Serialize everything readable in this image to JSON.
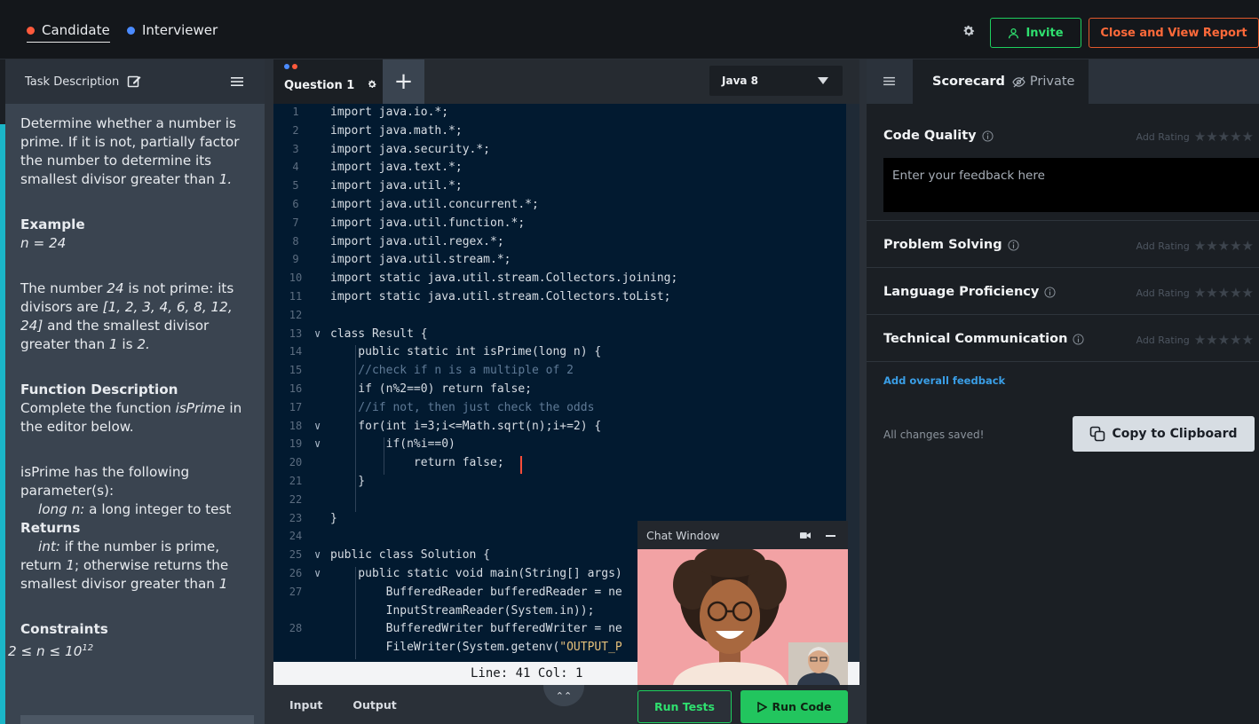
{
  "roles": {
    "candidate": "Candidate",
    "interviewer": "Interviewer",
    "candidate_color": "#ff5a3c",
    "interviewer_color": "#4b8bff"
  },
  "topbar": {
    "invite_label": "Invite",
    "report_label": "Close and View Report"
  },
  "task": {
    "header": "Task Description",
    "intro": "Determine whether a number is prime. If it is not, partially factor the number to determine its smallest divisor greater than ",
    "intro_num": "1.",
    "example_heading": "Example",
    "example_value": "n = 24",
    "explain_a": "The number ",
    "explain_n": "24",
    "explain_b": " is not prime: its divisors are ",
    "explain_divs": "[1, 2, 3, 4, 6, 8, 12, 24]",
    "explain_c": " and the smallest divisor greater than ",
    "explain_one": "1",
    "explain_d": " is ",
    "explain_two": "2.",
    "func_heading": "Function Description",
    "func_a": "Complete the function ",
    "func_name": "isPrime",
    "func_b": " in the editor below.",
    "params_intro": "isPrime has the following parameter(s):",
    "param_name": "long n:",
    "param_desc": " a long integer to test",
    "returns_heading": "Returns",
    "ret_type": "int:",
    "ret_a": " if the number is prime, return ",
    "ret_one": "1",
    "ret_b": "; otherwise returns the smallest divisor greater than ",
    "ret_one_b": "1",
    "constraints_heading": "Constraints",
    "constraint": "2 ≤ n ≤ 10",
    "constraint_exp": "12"
  },
  "editor": {
    "tab_label": "Question 1",
    "add_tab": "+",
    "language": "Java 8",
    "status": "Line: 41 Col: 1",
    "lines": [
      {
        "n": "1",
        "text": "import java.io.*;"
      },
      {
        "n": "2",
        "text": "import java.math.*;"
      },
      {
        "n": "3",
        "text": "import java.security.*;"
      },
      {
        "n": "4",
        "text": "import java.text.*;"
      },
      {
        "n": "5",
        "text": "import java.util.*;"
      },
      {
        "n": "6",
        "text": "import java.util.concurrent.*;"
      },
      {
        "n": "7",
        "text": "import java.util.function.*;"
      },
      {
        "n": "8",
        "text": "import java.util.regex.*;"
      },
      {
        "n": "9",
        "text": "import java.util.stream.*;"
      },
      {
        "n": "10",
        "text": "import static java.util.stream.Collectors.joining;"
      },
      {
        "n": "11",
        "text": "import static java.util.stream.Collectors.toList;"
      },
      {
        "n": "12",
        "text": ""
      },
      {
        "n": "13",
        "text": "class Result {"
      },
      {
        "n": "14",
        "text": "    public static int isPrime(long n) {"
      },
      {
        "n": "15",
        "text": "    //check if n is a multiple of 2"
      },
      {
        "n": "16",
        "text": "    if (n%2==0) return false;"
      },
      {
        "n": "17",
        "text": "    //if not, then just check the odds"
      },
      {
        "n": "18",
        "text": "    for(int i=3;i<=Math.sqrt(n);i+=2) {"
      },
      {
        "n": "19",
        "text": "        if(n%i==0)"
      },
      {
        "n": "20",
        "text": "            return false;"
      },
      {
        "n": "21",
        "text": "    }"
      },
      {
        "n": "22",
        "text": ""
      },
      {
        "n": "23",
        "text": "}"
      },
      {
        "n": "24",
        "text": ""
      },
      {
        "n": "25",
        "text": "public class Solution {"
      },
      {
        "n": "26",
        "text": "    public static void main(String[] args)"
      },
      {
        "n": "27",
        "text": "        BufferedReader bufferedReader = ne"
      },
      {
        "n": "",
        "text": "        InputStreamReader(System.in));"
      },
      {
        "n": "28",
        "text": "        BufferedWriter bufferedWriter = ne"
      },
      {
        "n": "",
        "text": "        FileWriter(System.getenv(\"OUTPUT_P"
      }
    ]
  },
  "io": {
    "input_label": "Input",
    "output_label": "Output"
  },
  "chat": {
    "title": "Chat Window",
    "run_tests": "Run Tests",
    "run_code": "Run Code"
  },
  "scorecard": {
    "tab_label": "Scorecard",
    "private_label": "Private",
    "add_rating": "Add Rating",
    "stars": "★★★★★",
    "categories": [
      {
        "title": "Code Quality"
      },
      {
        "title": "Problem Solving"
      },
      {
        "title": "Language Proficiency"
      },
      {
        "title": "Technical Communication"
      }
    ],
    "feedback_placeholder": "Enter your feedback here",
    "add_overall": "Add overall feedback",
    "saved": "All changes saved!",
    "copy_label": "Copy to Clipboard"
  },
  "colors": {
    "accent_green": "#22c55e",
    "report_orange": "#ff6a3a",
    "link_blue": "#3a9ee6",
    "editor_bg": "#021a30"
  }
}
